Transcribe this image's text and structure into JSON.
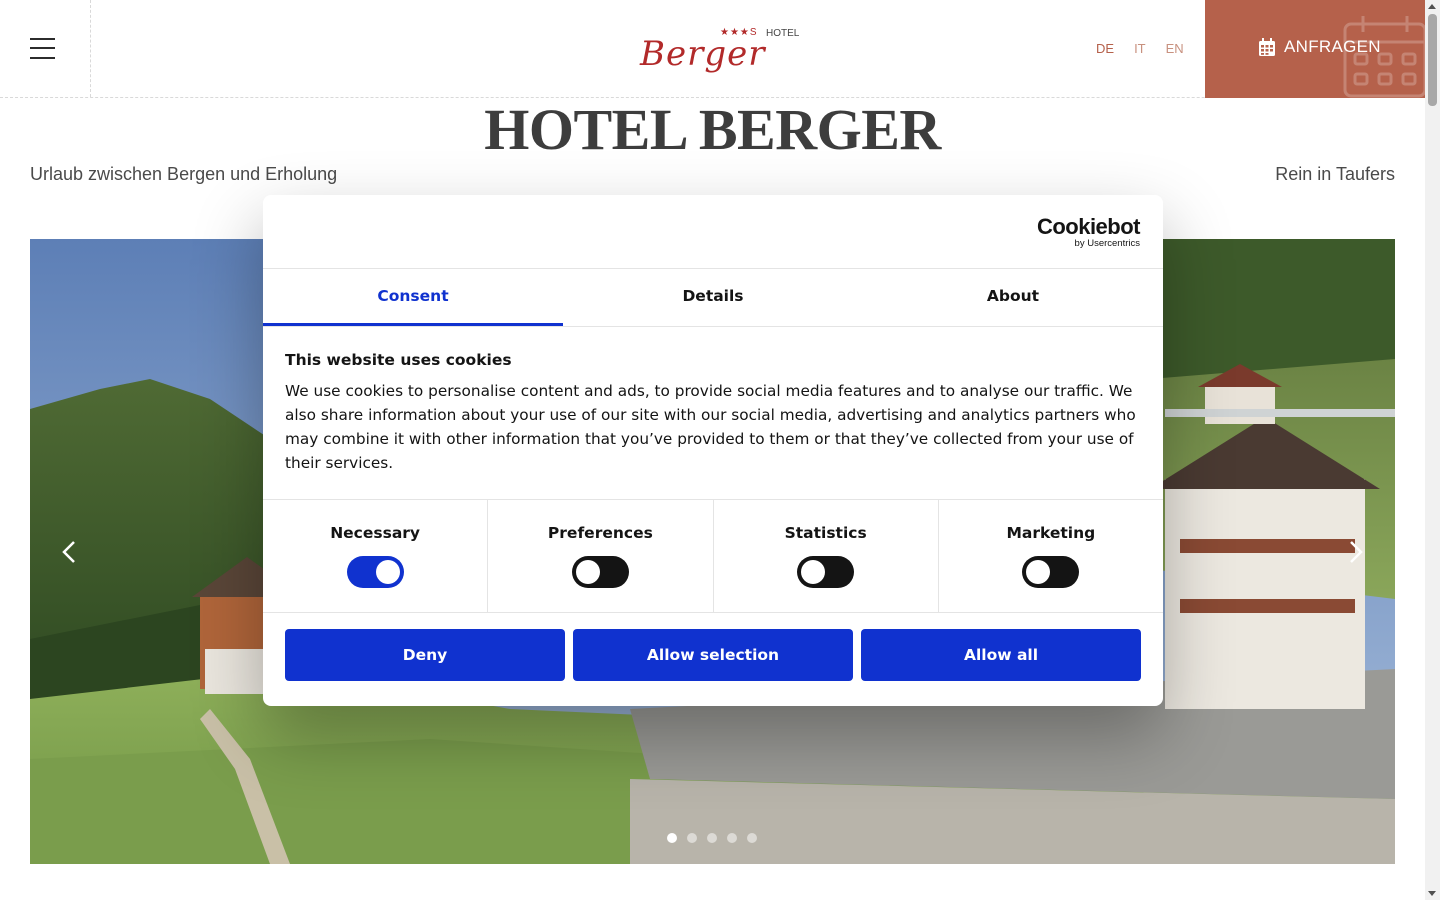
{
  "header": {
    "logo": {
      "stars": "★★★S",
      "hotel_word": "HOTEL",
      "script_name": "Berger"
    },
    "languages": [
      {
        "code": "DE",
        "active": true
      },
      {
        "code": "IT",
        "active": false
      },
      {
        "code": "EN",
        "active": false
      }
    ],
    "cta_label": "ANFRAGEN"
  },
  "intro": {
    "title": "HOTEL BERGER",
    "tagline": "Urlaub zwischen Bergen und Erholung",
    "location": "Rein in Taufers"
  },
  "hero": {
    "slide_count": 5,
    "active_slide": 1
  },
  "cookie_dialog": {
    "brand_name": "Cookiebot",
    "brand_sub": "by Usercentrics",
    "tabs": [
      {
        "label": "Consent",
        "active": true
      },
      {
        "label": "Details",
        "active": false
      },
      {
        "label": "About",
        "active": false
      }
    ],
    "heading": "This website uses cookies",
    "text": "We use cookies to personalise content and ads, to provide social media features and to analyse our traffic. We also share information about your use of our site with our social media, advertising and analytics partners who may combine it with other information that you’ve provided to them or that they’ve collected from your use of their services.",
    "categories": [
      {
        "label": "Necessary",
        "on": true
      },
      {
        "label": "Preferences",
        "on": false
      },
      {
        "label": "Statistics",
        "on": false
      },
      {
        "label": "Marketing",
        "on": false
      }
    ],
    "buttons": {
      "deny": "Deny",
      "allow_selection": "Allow selection",
      "allow_all": "Allow all"
    }
  },
  "colors": {
    "accent": "#b5614b",
    "logo_red": "#b22a2a",
    "cookiebot_blue": "#1032cf"
  }
}
